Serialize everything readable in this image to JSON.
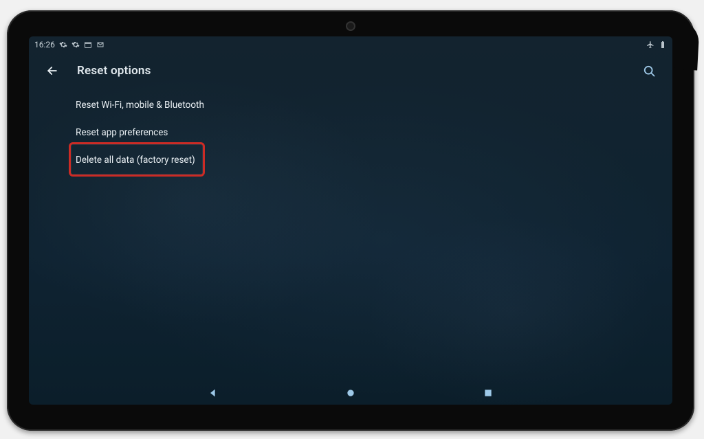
{
  "status": {
    "time": "16:26",
    "icons_left": [
      "gear-icon",
      "gear-icon",
      "calendar-icon",
      "mail-m-icon"
    ],
    "icons_right": [
      "airplane-mode-icon",
      "battery-icon"
    ]
  },
  "appbar": {
    "title": "Reset options"
  },
  "options": [
    {
      "label": "Reset Wi-Fi, mobile & Bluetooth"
    },
    {
      "label": "Reset app preferences"
    },
    {
      "label": "Delete all data (factory reset)"
    }
  ],
  "highlighted_index": 2,
  "color": {
    "accent": "#9ec9e8",
    "highlight": "#cc2b25"
  }
}
